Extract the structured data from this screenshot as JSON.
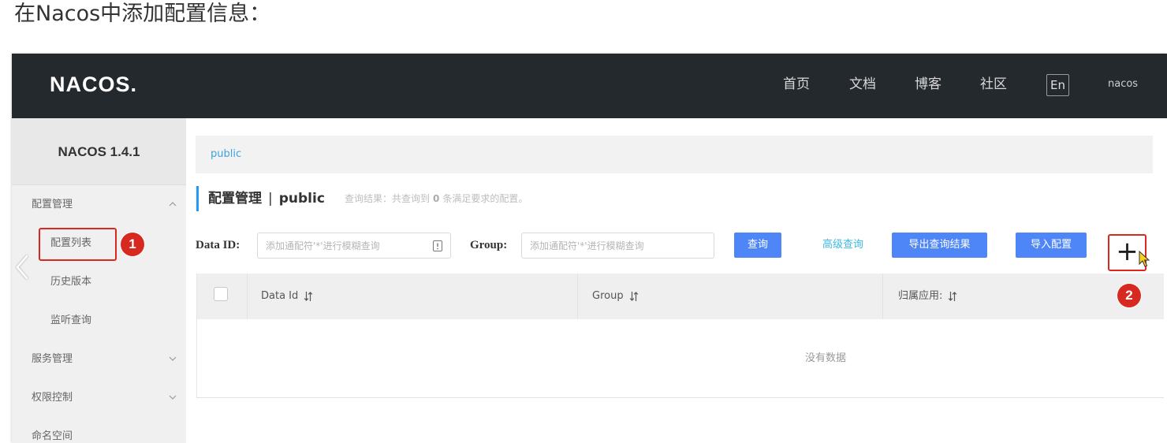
{
  "page_heading": "在Nacos中添加配置信息：",
  "colors": {
    "header_bg": "#24292e",
    "primary_button": "#4f86f7",
    "link": "#3cb8e0",
    "annotation_red": "#d7291f",
    "accent_bar": "#209bfa",
    "namespace_text": "#3ca3dd"
  },
  "header": {
    "logo": "NACOS.",
    "nav": [
      {
        "label": "首页"
      },
      {
        "label": "文档"
      },
      {
        "label": "博客"
      },
      {
        "label": "社区"
      }
    ],
    "language_toggle": "En",
    "user": "nacos"
  },
  "sidebar": {
    "version_title": "NACOS 1.4.1",
    "menu": [
      {
        "label": "配置管理",
        "expanded": true,
        "children": [
          {
            "label": "配置列表"
          },
          {
            "label": "历史版本"
          },
          {
            "label": "监听查询"
          }
        ]
      },
      {
        "label": "服务管理",
        "expanded": false
      },
      {
        "label": "权限控制",
        "expanded": false
      },
      {
        "label": "命名空间"
      }
    ]
  },
  "main": {
    "namespace_breadcrumb": "public",
    "title": "配置管理",
    "title_separator": "|",
    "title_namespace": "public",
    "query_result": {
      "prefix": "查询结果：共查询到",
      "count": "0",
      "suffix": "条满足要求的配置。"
    },
    "search": {
      "data_id_label": "Data ID:",
      "data_id_placeholder": "添加通配符'*'进行模糊查询",
      "data_id_value": "",
      "group_label": "Group:",
      "group_placeholder": "添加通配符'*'进行模糊查询",
      "group_value": "",
      "query_button": "查询",
      "advanced_query_link": "高级查询",
      "export_button": "导出查询结果",
      "import_button": "导入配置",
      "add_button": "+"
    },
    "table": {
      "columns": [
        {
          "label": "Data Id",
          "sortable": true
        },
        {
          "label": "Group",
          "sortable": true
        },
        {
          "label": "归属应用:",
          "sortable": true
        }
      ],
      "rows": [],
      "empty_text": "没有数据"
    }
  },
  "annotations": {
    "badge_1": "1",
    "badge_2": "2"
  },
  "icons": {
    "menu_toggle": "chevron-icon",
    "sort": "sort-icon",
    "input_hint": "input-hint-icon",
    "cursor": "mouse-cursor-icon",
    "previous": "chevron-left-icon"
  }
}
